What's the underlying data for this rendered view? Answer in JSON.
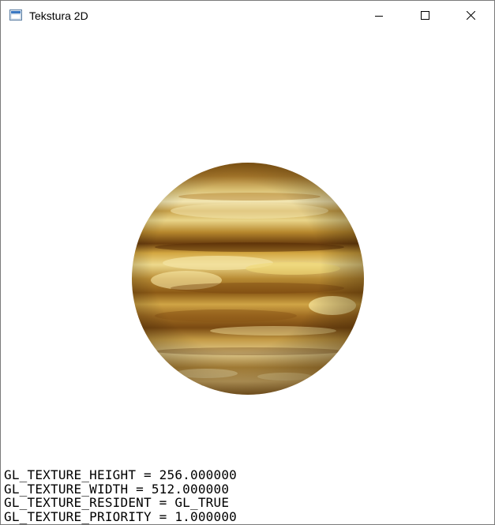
{
  "window": {
    "title": "Tekstura 2D",
    "app_icon": "window-app-icon",
    "controls": {
      "minimize_icon": "minimize-icon",
      "maximize_icon": "maximize-icon",
      "close_icon": "close-icon"
    }
  },
  "scene": {
    "object": "textured-sphere",
    "texture_colors": [
      "#8a5a14",
      "#c9a24a",
      "#f0e2a0",
      "#6b3e0e",
      "#e0c05a"
    ]
  },
  "gl_info": {
    "lines": [
      "GL_TEXTURE_HEIGHT = 256.000000",
      "GL_TEXTURE_WIDTH = 512.000000",
      "GL_TEXTURE_RESIDENT = GL_TRUE",
      "GL_TEXTURE_PRIORITY = 1.000000"
    ]
  }
}
